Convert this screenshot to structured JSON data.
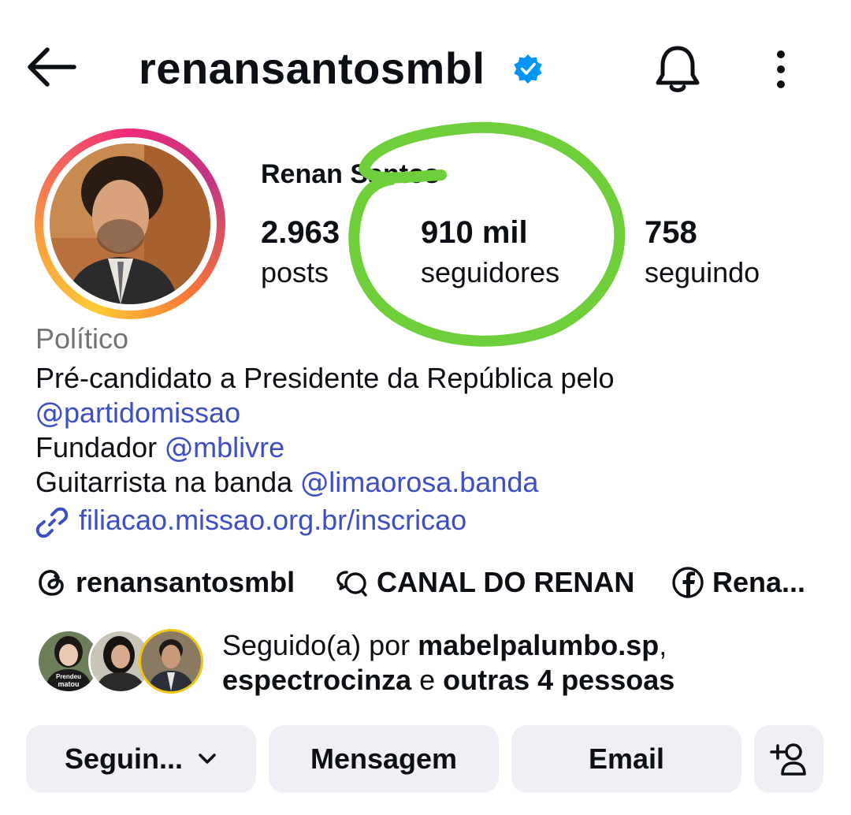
{
  "header": {
    "username": "renansantosmbl",
    "back_icon": "arrow-left-icon",
    "verified_icon": "verified-badge-icon",
    "notifications_icon": "bell-icon",
    "more_icon": "more-vertical-icon"
  },
  "profile": {
    "display_name": "Renan Santos",
    "stats": [
      {
        "value": "2.963",
        "label": "posts"
      },
      {
        "value": "910 mil",
        "label": "seguidores"
      },
      {
        "value": "758",
        "label": "seguindo"
      }
    ],
    "category": "Político",
    "bio": {
      "line1": "Pré-candidato a Presidente da República pelo",
      "line2_mention": "partidomissao",
      "line3_prefix": "Fundador ",
      "line3_mention": "mblivre",
      "line4_prefix": "Guitarrista na banda ",
      "line4_mention": "limaorosa.banda"
    },
    "link": "filiacao.missao.org.br/inscricao"
  },
  "social_chips": [
    {
      "icon": "threads-icon",
      "label": "renansantosmbl"
    },
    {
      "icon": "channel-chat-icon",
      "label": "CANAL DO RENAN"
    },
    {
      "icon": "facebook-icon",
      "label": "Rena..."
    }
  ],
  "followed_by": {
    "prefix": "Seguido(a) por ",
    "user1": "mabelpalumbo.sp",
    "separator": ",",
    "user2": "espectrocinza",
    "connector": " e ",
    "others": "outras 4 pessoas",
    "avatar1_shirt_text_1": "Prendeu",
    "avatar1_shirt_text_2": "matou"
  },
  "buttons": {
    "following": "Seguin...",
    "message": "Mensagem",
    "email": "Email",
    "add_person_icon": "add-person-icon"
  },
  "colors": {
    "link": "#3d4fc2",
    "button_bg": "#efeff5",
    "verified": "#0095f6",
    "highlight_annotation": "#6fcf3a"
  }
}
